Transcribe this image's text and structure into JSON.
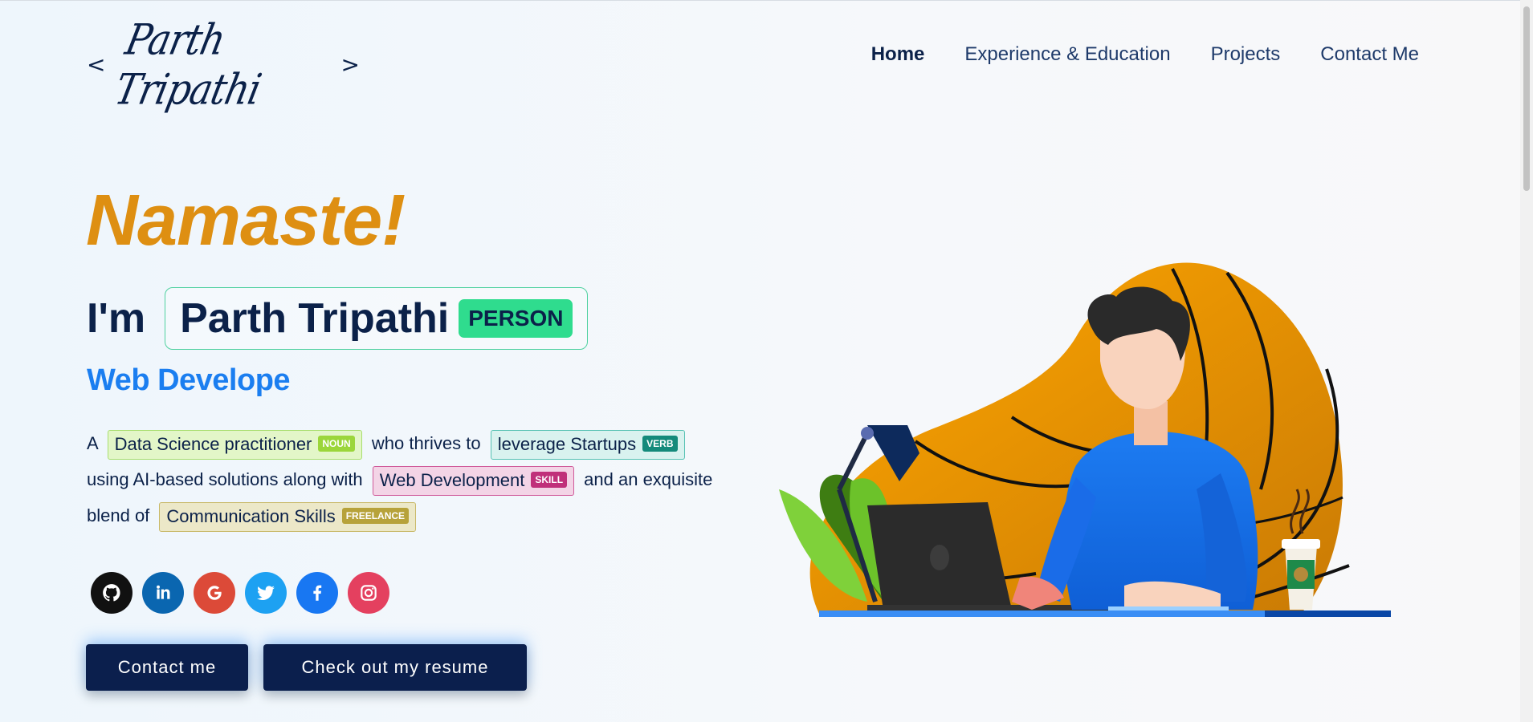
{
  "logo": {
    "open": "<",
    "signature": "Parth Tripathi",
    "close": ">"
  },
  "nav": [
    {
      "label": "Home",
      "active": true
    },
    {
      "label": "Experience & Education",
      "active": false
    },
    {
      "label": "Projects",
      "active": false
    },
    {
      "label": "Contact Me",
      "active": false
    }
  ],
  "hero": {
    "greeting": "Namaste!",
    "im": "I'm",
    "name": "Parth Tripathi",
    "name_tag": "PERSON",
    "role": "Web Develope"
  },
  "description": {
    "a": "A",
    "chip1": {
      "text": "Data Science practitioner",
      "label": "NOUN",
      "bg": "#e3f6c8",
      "border": "#a8de6e",
      "label_bg": "#9bd63a"
    },
    "mid1": "who thrives to",
    "chip2": {
      "text": "leverage Startups",
      "label": "VERB",
      "bg": "#d9f2ef",
      "border": "#56c2b3",
      "label_bg": "#148a7b"
    },
    "line2": "using AI-based solutions along with",
    "chip3": {
      "text": "Web Development",
      "label": "SKILL",
      "bg": "#f3d4e6",
      "border": "#d05a9a",
      "label_bg": "#c0307a"
    },
    "mid2": "and an exquisite",
    "line3": "blend of",
    "chip4": {
      "text": "Communication Skills",
      "label": "FREELANCE",
      "bg": "#ece8c8",
      "border": "#c9b969",
      "label_bg": "#b7a23a"
    }
  },
  "socials": [
    {
      "icon": "github-icon",
      "color": "#111111"
    },
    {
      "icon": "linkedin-icon",
      "color": "#0a66b0"
    },
    {
      "icon": "google-icon",
      "color": "#dc4a38"
    },
    {
      "icon": "twitter-icon",
      "color": "#1da1f2"
    },
    {
      "icon": "facebook-icon",
      "color": "#1877f2"
    },
    {
      "icon": "instagram-icon",
      "color": "#e4405f"
    }
  ],
  "buttons": {
    "contact": "Contact me",
    "resume": "Check out my resume"
  }
}
